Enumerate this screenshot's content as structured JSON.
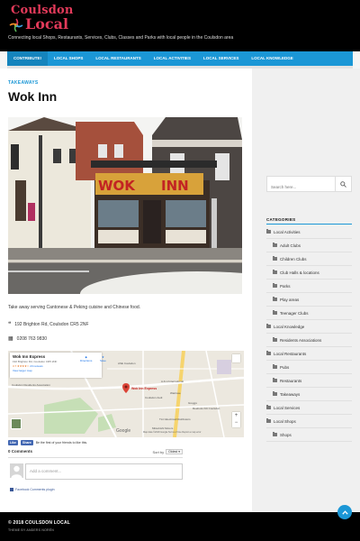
{
  "site": {
    "logo_line1": "Coulsdon",
    "logo_line2": "Local",
    "tagline": "Connecting local Shops, Restaurants, Services, Clubs, Classes and Parks with local people in the Coulsdon area"
  },
  "nav": {
    "items": [
      "CONTRIBUTE!",
      "LOCAL SHOPS",
      "LOCAL RESTAURANTS",
      "LOCAL ACTIVITIES",
      "LOCAL SERVICES",
      "LOCAL KNOWLEDGE"
    ]
  },
  "post": {
    "category": "TAKEAWAYS",
    "title": "Wok Inn",
    "sign_left": "WOK",
    "sign_right": "INN",
    "description": "Take away serving Cantonese & Peking cuisine and Chinese food.",
    "address": "192 Brighton Rd, Coulsdon CR5 2NF",
    "phone": "0208 763 9830"
  },
  "map": {
    "place_name": "Wok Inn Express",
    "place_address": "192 Brighton Rd, Coulsdon CR5 2NF",
    "rating": "3.7",
    "reviews": "23 reviews",
    "larger_map": "View larger map",
    "directions": "Directions",
    "save": "Save",
    "pin_label": "Wok Inn Express",
    "labels": [
      "ASE Coulsdon",
      "A & H International",
      "Waitrose",
      "Greggs",
      "Reeboks Kilt Coulsdon",
      "Coulsdon Audi",
      "TLC Electrical Distributors",
      "Coulsdon Residents Association",
      "Mitsubishi Motors"
    ],
    "google": "Google",
    "footer": "Map data ©2018 Google   Terms of Use   Report a map error"
  },
  "facebook": {
    "like": "Like",
    "share": "Share",
    "like_text": "Be the first of your friends to like this.",
    "comments_count": "0 Comments",
    "sort_label": "Sort by",
    "sort_value": "Oldest",
    "comment_placeholder": "Add a comment...",
    "plugin": "Facebook Comments plugin"
  },
  "sidebar": {
    "search_placeholder": "Search here...",
    "categories_title": "CATEGORIES",
    "categories": [
      {
        "label": "Local Activities",
        "child": false
      },
      {
        "label": "Adult Clubs",
        "child": true
      },
      {
        "label": "Children Clubs",
        "child": true
      },
      {
        "label": "Club Halls & locations",
        "child": true
      },
      {
        "label": "Parks",
        "child": true
      },
      {
        "label": "Play areas",
        "child": true
      },
      {
        "label": "Teenager Clubs",
        "child": true
      },
      {
        "label": "Local Knowledge",
        "child": false
      },
      {
        "label": "Residents Associations",
        "child": true
      },
      {
        "label": "Local Restaurants",
        "child": false
      },
      {
        "label": "Pubs",
        "child": true
      },
      {
        "label": "Restaurants",
        "child": true
      },
      {
        "label": "Takeaways",
        "child": true
      },
      {
        "label": "Local Services",
        "child": false
      },
      {
        "label": "Local Shops",
        "child": false
      },
      {
        "label": "Shops",
        "child": true
      }
    ]
  },
  "footer": {
    "copyright": "© 2018 COULSDON LOCAL",
    "theme": "THEME BY ANDERS NORÉN"
  },
  "colors": {
    "accent": "#1b97d6",
    "logo": "#e23a5a",
    "sign": "#e8a820"
  }
}
